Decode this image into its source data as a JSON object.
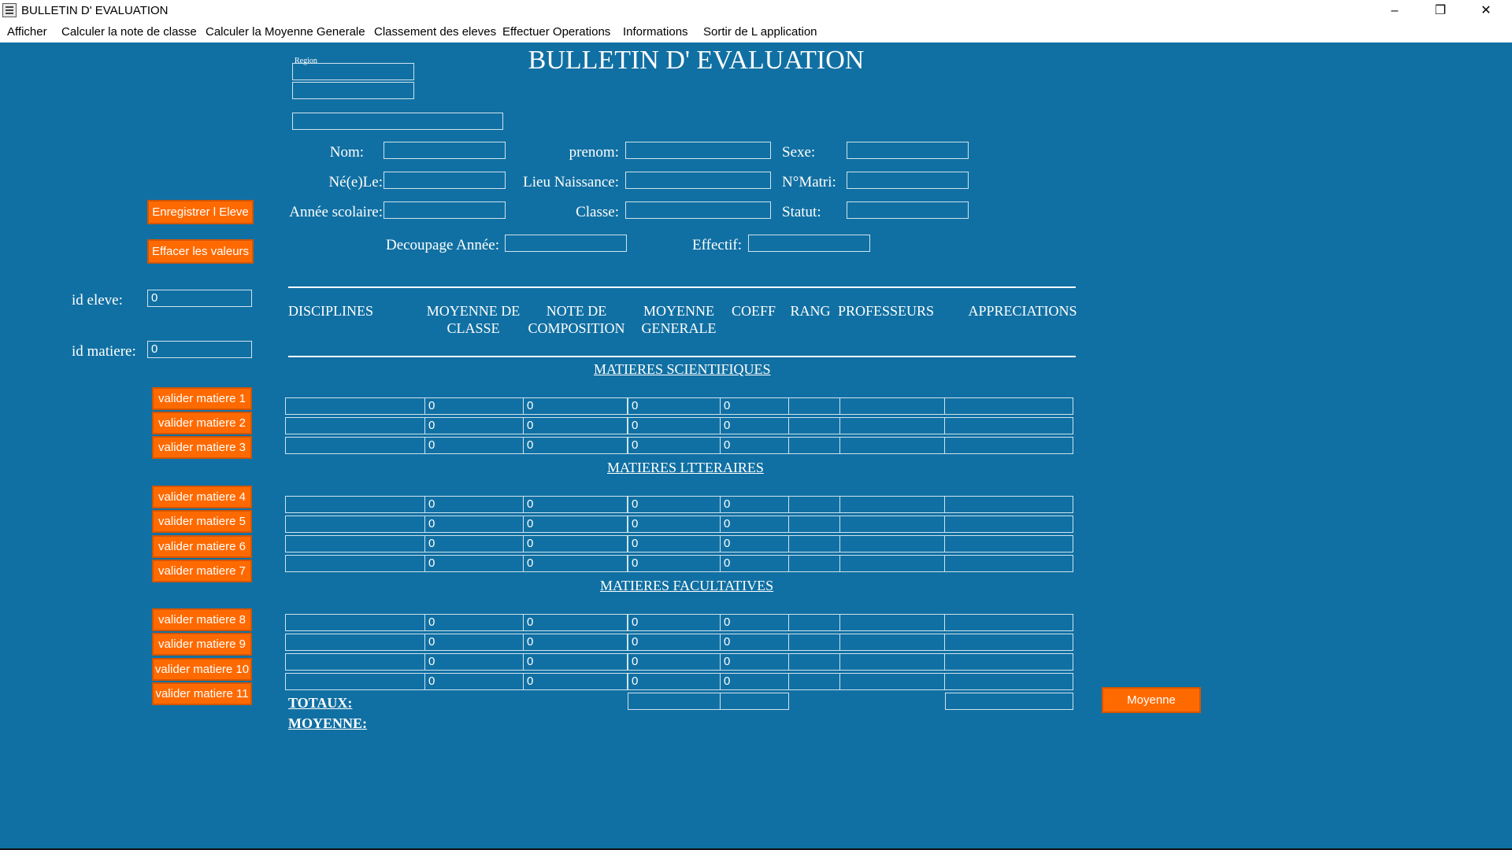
{
  "window": {
    "title": "BULLETIN D' EVALUATION",
    "minimize": "–",
    "restore": "❐",
    "close": "✕"
  },
  "menu": [
    "Afficher",
    "Calculer la note de classe",
    "Calculer la Moyenne Generale",
    "Classement des eleves",
    "Effectuer Operations",
    "Informations",
    "Sortir de L application"
  ],
  "form": {
    "title": "BULLETIN D' EVALUATION",
    "region_label": "Region",
    "labels": {
      "nom": "Nom:",
      "prenom": "prenom:",
      "sexe": "Sexe:",
      "ne_le": "Né(e)Le:",
      "lieu_naissance": "Lieu Naissance:",
      "nomatri": "N°Matri:",
      "annee_scolaire": "Année scolaire:",
      "classe": "Classe:",
      "statut": "Statut:",
      "decoupage": "Decoupage Année:",
      "effectif": "Effectif:",
      "id_eleve": "id eleve:",
      "id_matiere": "id matiere:"
    },
    "values": {
      "id_eleve": "0",
      "id_matiere": "0"
    }
  },
  "buttons": {
    "enregistrer": "Enregistrer l Eleve",
    "effacer": "Effacer les valeurs",
    "moyenne": "Moyenne",
    "valider": [
      "valider matiere 1",
      "valider matiere 2",
      "valider matiere 3",
      "valider matiere 4",
      "valider matiere 5",
      "valider matiere 6",
      "valider matiere 7",
      "valider matiere 8",
      "valider matiere 9",
      "valider matiere 10",
      "valider matiere 11"
    ]
  },
  "table": {
    "headers": {
      "disciplines": "DISCIPLINES",
      "moyenne_classe_1": "MOYENNE DE",
      "moyenne_classe_2": "CLASSE",
      "note_compo_1": "NOTE DE",
      "note_compo_2": "COMPOSITION",
      "moyenne_gen_1": "MOYENNE",
      "moyenne_gen_2": "GENERALE",
      "coeff": "COEFF",
      "rang": "RANG",
      "professeurs": "PROFESSEURS",
      "appreciations": "APPRECIATIONS"
    },
    "sections": {
      "scientifiques": "MATIERES SCIENTIFIQUES",
      "litteraires": "MATIERES LTTERAIRES",
      "facultatives": "MATIERES FACULTATIVES"
    },
    "zero": "0",
    "totaux": "TOTAUX:",
    "moyenne": "MOYENNE:"
  }
}
